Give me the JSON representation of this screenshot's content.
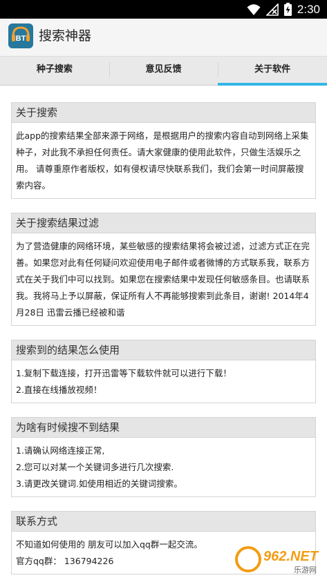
{
  "status_bar": {
    "time": "2:30",
    "icons": [
      "wifi-icon",
      "no-signal-icon",
      "battery-charging-icon"
    ]
  },
  "app_bar": {
    "logo_text": "BT",
    "title": "搜索神器"
  },
  "tabs": [
    {
      "label": "种子搜索",
      "active": false
    },
    {
      "label": "意见反馈",
      "active": false
    },
    {
      "label": "关于软件",
      "active": true
    }
  ],
  "sections": [
    {
      "title": "关于搜索",
      "lines": [
        "此app的搜索结果全部来源于网络，是根据用户的搜索内容自动到网络上采集种子，对此我不承担任何责任。请大家健康的使用此软件，只做生活娱乐之用。 请尊重原作者版权，如有侵权请尽快联系我们，我们会第一时间屏蔽搜索内容。"
      ]
    },
    {
      "title": "关于搜索结果过滤",
      "lines": [
        "为了营造健康的网络环境，某些敏感的搜索结果将会被过滤，过滤方式正在完善。如果您对此有任何疑问欢迎使用电子邮件或者微博的方式联系我，联系方式在关于我们中可以找到。如果您在搜索结果中发现任何敏感条目。也请联系我。我将马上予以屏蔽，保证所有人不再能够搜索到此条目，谢谢! 2014年4月28日 迅雷云播已经被和谐"
      ]
    },
    {
      "title": "搜索到的结果怎么使用",
      "lines": [
        "1.复制下载连接，打开迅雷等下载软件就可以进行下载！",
        "2.直接在线播放视频！"
      ]
    },
    {
      "title": "为啥有时候搜不到结果",
      "lines": [
        "1.请确认网络连接正常,",
        "2.您可以对某一个关键词多进行几次搜索.",
        "3.请更改关键词.如使用相近的关键词搜索。"
      ]
    },
    {
      "title": "联系方式",
      "lines": [
        "不知道如何使用的 朋友可以加入qq群一起交流。",
        "官方qq群： 136794226"
      ]
    }
  ],
  "watermark": {
    "brand": "962.NET",
    "sub": "乐游网",
    "accent_color": "#f39c12"
  },
  "colors": {
    "tab_indicator": "#33b5e5",
    "logo_bg": "#26789c",
    "logo_text": "#f0a030"
  }
}
